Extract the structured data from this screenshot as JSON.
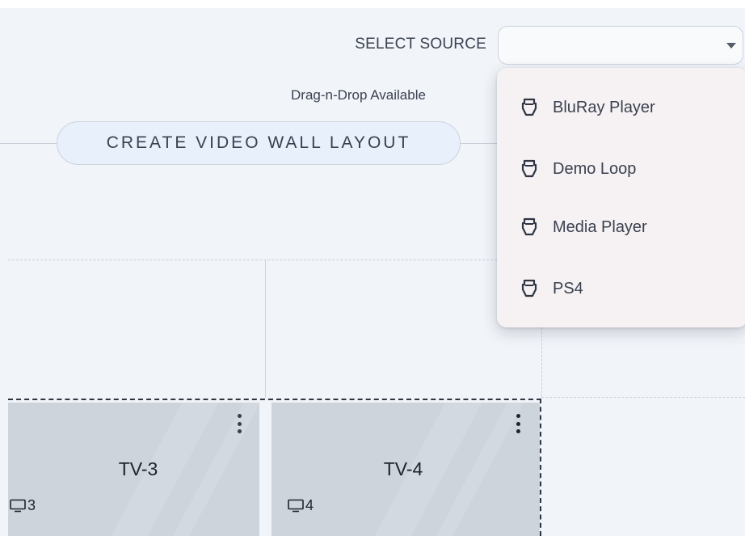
{
  "header": {
    "select_label": "SELECT SOURCE",
    "select_value": "",
    "dnd_hint": "Drag-n-Drop Available"
  },
  "create_button": {
    "label": "CREATE VIDEO WALL LAYOUT"
  },
  "source_menu": {
    "items": [
      {
        "label": "BluRay Player",
        "icon": "hdmi-icon"
      },
      {
        "label": "Demo Loop",
        "icon": "hdmi-icon"
      },
      {
        "label": "Media Player",
        "icon": "hdmi-icon"
      },
      {
        "label": "PS4",
        "icon": "hdmi-icon"
      }
    ]
  },
  "tiles": [
    {
      "name": "TV-3",
      "number": "3",
      "icon": "display-icon"
    },
    {
      "name": "TV-4",
      "number": "4",
      "icon": "display-icon"
    }
  ],
  "colors": {
    "background": "#f1f4f9",
    "button_fill": "#e7f0fb",
    "tile_fill": "#cdd4dc",
    "menu_fill": "#f6f2f3",
    "text": "#3a4150"
  }
}
